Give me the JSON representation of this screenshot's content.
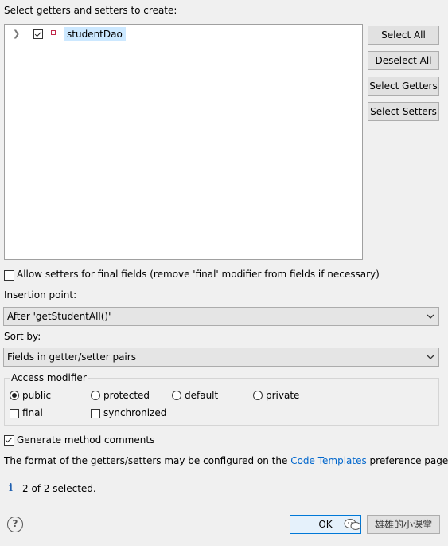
{
  "dialog": {
    "select_label": "Select getters and setters to create:",
    "tree": {
      "items": [
        {
          "label": "studentDao",
          "checked": true,
          "icon": "private-field-icon"
        }
      ]
    },
    "buttons": {
      "select_all": "Select All",
      "deselect_all": "Deselect All",
      "select_getters": "Select Getters",
      "select_setters": "Select Setters"
    },
    "allow_setters": {
      "label": "Allow setters for final fields (remove 'final' modifier from fields if necessary)",
      "checked": false
    },
    "insertion_point": {
      "label": "Insertion point:",
      "value": "After 'getStudentAll()'"
    },
    "sort_by": {
      "label": "Sort by:",
      "value": "Fields in getter/setter pairs"
    },
    "access_modifier": {
      "title": "Access modifier",
      "options": [
        "public",
        "protected",
        "default",
        "private"
      ],
      "selected": "public",
      "final_label": "final",
      "synchronized_label": "synchronized"
    },
    "generate_comments": {
      "label": "Generate method comments",
      "checked": true
    },
    "format_note": {
      "prefix": "The format of the getters/setters may be configured on the ",
      "link": "Code Templates",
      "suffix": " preference page."
    },
    "status": "2 of 2 selected.",
    "ok_label": "OK",
    "watermark": "雄雄的小课堂"
  },
  "colors": {
    "selection": "#cce8ff",
    "link": "#0066cc",
    "default_button_border": "#0078d7"
  }
}
